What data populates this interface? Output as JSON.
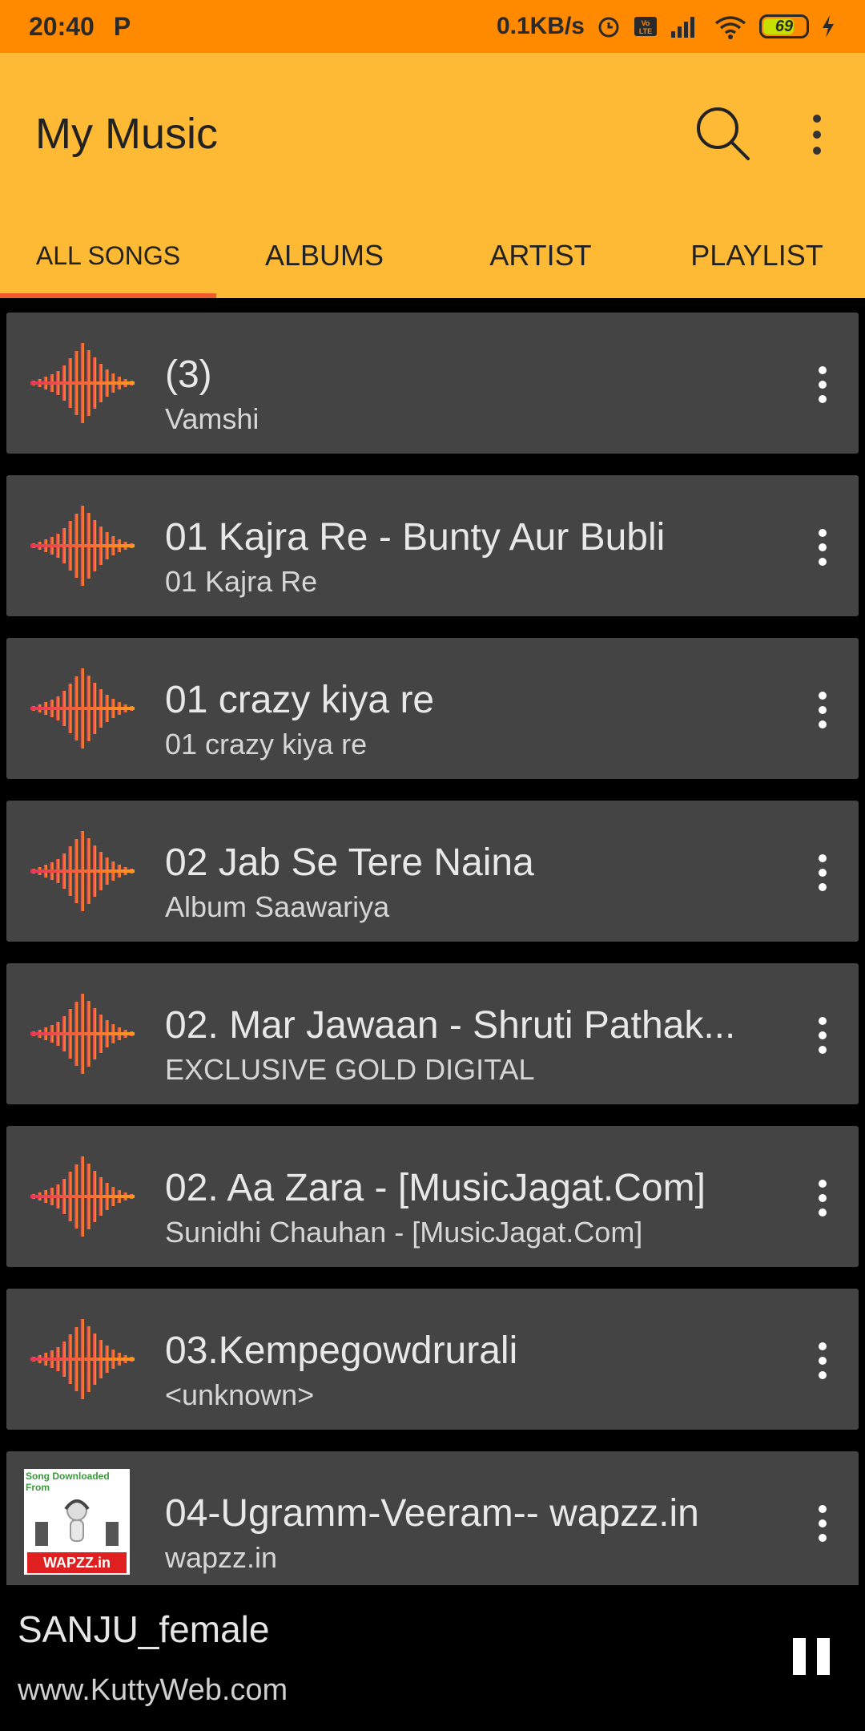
{
  "status_bar": {
    "time": "20:40",
    "app_icon": "P",
    "network_speed": "0.1KB/s",
    "icons": [
      "alarm-icon",
      "volte-icon",
      "signal-icon",
      "wifi-icon"
    ],
    "battery": "69"
  },
  "appbar": {
    "title": "My Music",
    "color": "#ffba35"
  },
  "tabs": [
    {
      "label": "ALL SONGS",
      "active": true
    },
    {
      "label": "ALBUMS",
      "active": false
    },
    {
      "label": "ARTIST",
      "active": false
    },
    {
      "label": "PLAYLIST",
      "active": false
    }
  ],
  "songs": [
    {
      "title": "(3)",
      "subtitle": "Vamshi",
      "art": "waveform-icon"
    },
    {
      "title": "01 Kajra Re - Bunty Aur Bubli",
      "subtitle": "01 Kajra Re",
      "art": "waveform-icon"
    },
    {
      "title": "01 crazy kiya re",
      "subtitle": "01 crazy kiya re",
      "art": "waveform-icon"
    },
    {
      "title": "02 Jab Se Tere Naina",
      "subtitle": "Album Saawariya",
      "art": "waveform-icon"
    },
    {
      "title": "02.  Mar Jawaan - Shruti Pathak...",
      "subtitle": "EXCLUSIVE GOLD DIGITAL",
      "art": "waveform-icon"
    },
    {
      "title": "02. Aa Zara - [MusicJagat.Com]",
      "subtitle": "Sunidhi Chauhan - [MusicJagat.Com]",
      "art": "waveform-icon"
    },
    {
      "title": "03.Kempegowdrurali",
      "subtitle": "<unknown>",
      "art": "waveform-icon"
    },
    {
      "title": "04-Ugramm-Veeram-- wapzz.in",
      "subtitle": "wapzz.in",
      "art": "album-thumbnail",
      "thumb_text": "Song Downloaded From",
      "thumb_logo": "WAPZZ.in"
    }
  ],
  "now_playing": {
    "title": "SANJU_female",
    "subtitle": "www.KuttyWeb.com"
  }
}
